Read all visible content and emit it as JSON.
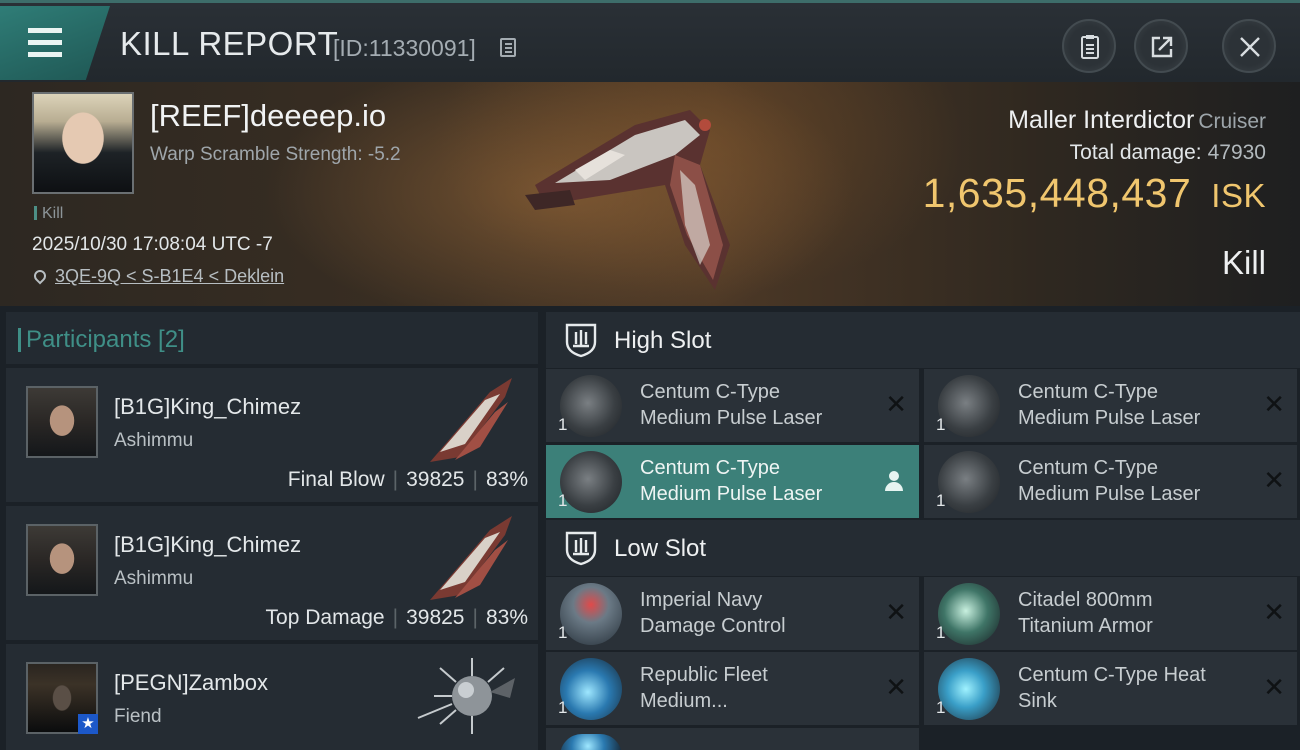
{
  "header": {
    "title": "KILL REPORT",
    "report_id": "[ID:11330091]",
    "icons": [
      "menu-icon",
      "copy-icon",
      "clipboard-icon",
      "share-icon",
      "close-icon"
    ]
  },
  "victim": {
    "name": "[REEF]deeeep.io",
    "warp_scramble": "Warp Scramble Strength: -5.2",
    "kill_tag": "Kill",
    "timestamp": "2025/10/30 17:08:04 UTC -7",
    "location": "3QE-9Q < S-B1E4 < Deklein",
    "ship_name": "Maller Interdictor",
    "ship_class": "Cruiser",
    "total_damage_label": "Total damage:",
    "total_damage": "47930",
    "isk_value": "1,635,448,437",
    "isk_unit": "ISK",
    "result": "Kill"
  },
  "participants": {
    "label": "Participants [2]",
    "list": [
      {
        "name": "[B1G]King_Chimez",
        "ship": "Ashimmu",
        "role": "Final Blow",
        "damage": "39825",
        "percent": "83%"
      },
      {
        "name": "[B1G]King_Chimez",
        "ship": "Ashimmu",
        "role": "Top Damage",
        "damage": "39825",
        "percent": "83%"
      },
      {
        "name": "[PEGN]Zambox",
        "ship": "Fiend",
        "role": "",
        "damage": "",
        "percent": ""
      }
    ]
  },
  "fitting": {
    "high_slot": {
      "label": "High Slot",
      "modules": [
        {
          "line1": "Centum C-Type",
          "line2": "Medium Pulse Laser",
          "qty": "1"
        },
        {
          "line1": "Centum C-Type",
          "line2": "Medium Pulse Laser",
          "qty": "1"
        },
        {
          "line1": "Centum C-Type",
          "line2": "Medium Pulse Laser",
          "qty": "1"
        },
        {
          "line1": "Centum C-Type",
          "line2": "Medium Pulse Laser",
          "qty": "1"
        }
      ]
    },
    "low_slot": {
      "label": "Low Slot",
      "modules": [
        {
          "line1": "Imperial Navy",
          "line2": "Damage Control",
          "qty": "1"
        },
        {
          "line1": "Citadel 800mm",
          "line2": "Titanium Armor",
          "qty": "1"
        },
        {
          "line1": "Republic Fleet",
          "line2": "Medium...",
          "qty": "1"
        },
        {
          "line1": "Centum C-Type Heat",
          "line2": "Sink",
          "qty": "1"
        }
      ]
    }
  },
  "colors": {
    "accent": "#3f8f87",
    "isk": "#f0c66e",
    "active_module": "#3c8079"
  }
}
